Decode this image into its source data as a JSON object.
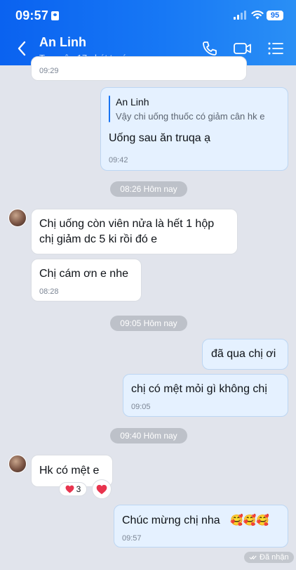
{
  "status_bar": {
    "time": "09:57",
    "battery": "95"
  },
  "header": {
    "title": "An Linh",
    "subtitle": "Truy cập 17 phút trước"
  },
  "messages": {
    "m0_time": "09:29",
    "m1": {
      "quote_name": "An Linh",
      "quote_text": "Vậy chi uống thuốc có giảm cân hk e",
      "text": "Uống sau ăn truqa ạ",
      "time": "09:42"
    },
    "sep1": "08:26 Hôm nay",
    "m2": {
      "line1": "Chị uống còn viên nửa là hết 1 hộp",
      "line2": "chị giảm dc 5 ki rồi đó e"
    },
    "m3": {
      "text": "Chị cám ơn e nhe",
      "time": "08:28"
    },
    "sep2": "09:05 Hôm nay",
    "m4": {
      "text": "đã qua chị ơi"
    },
    "m5": {
      "text": "chị có mệt mỏi gì không chị",
      "time": "09:05"
    },
    "sep3": "09:40 Hôm nay",
    "m6": {
      "text": "Hk có mệt e",
      "reaction_count": "3"
    },
    "m7": {
      "text": "Chúc mừng chị nha",
      "emoji": "🥰🥰🥰",
      "time": "09:57"
    },
    "received_label": "Đã nhận"
  },
  "colors": {
    "header": "#1874f3",
    "background": "#e1e4ec",
    "my_bubble": "#e5f1ff",
    "their_bubble": "#ffffff",
    "heart": "#e8344e"
  }
}
